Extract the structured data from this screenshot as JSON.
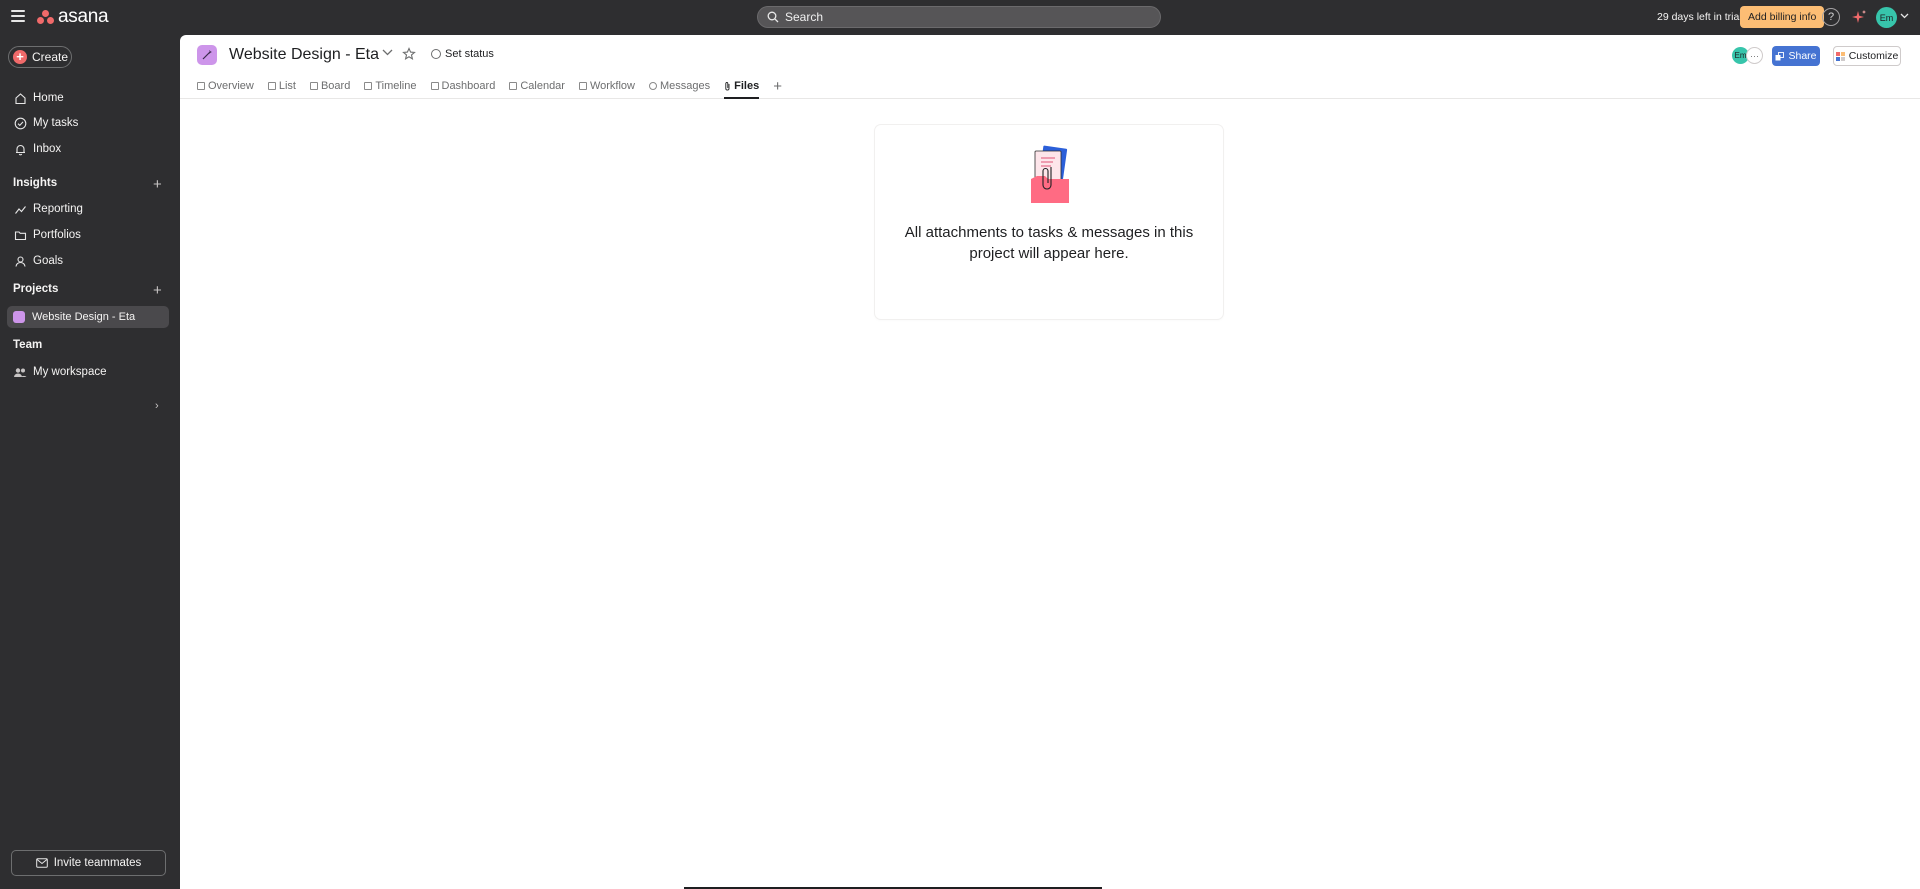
{
  "topbar": {
    "logo_text": "asana",
    "search_placeholder": "Search",
    "trial_text": "29 days left in trial",
    "billing_label": "Add billing info",
    "help_label": "?",
    "avatar_initials": "Em",
    "accent_color": "#f06a6a"
  },
  "sidebar": {
    "create_label": "Create",
    "nav": [
      {
        "label": "Home",
        "icon": "home-icon"
      },
      {
        "label": "My tasks",
        "icon": "check-circle-icon"
      },
      {
        "label": "Inbox",
        "icon": "bell-icon"
      }
    ],
    "insights_header": "Insights",
    "insights": [
      {
        "label": "Reporting",
        "icon": "trend-line-icon"
      },
      {
        "label": "Portfolios",
        "icon": "folder-icon"
      },
      {
        "label": "Goals",
        "icon": "person-icon"
      }
    ],
    "projects_header": "Projects",
    "projects": [
      {
        "label": "Website Design - Eta",
        "color": "#cd95ea"
      }
    ],
    "team_header": "Team",
    "team": [
      {
        "label": "My workspace",
        "icon": "people-icon"
      }
    ],
    "invite_label": "Invite teammates"
  },
  "project": {
    "title": "Website Design - Eta",
    "set_status_label": "Set status",
    "member_initials": "Em",
    "more_members": "···",
    "share_label": "Share",
    "customize_label": "Customize",
    "tabs": [
      {
        "label": "Overview",
        "icon": "overview-icon"
      },
      {
        "label": "List",
        "icon": "list-icon"
      },
      {
        "label": "Board",
        "icon": "board-icon"
      },
      {
        "label": "Timeline",
        "icon": "timeline-icon"
      },
      {
        "label": "Dashboard",
        "icon": "dashboard-icon"
      },
      {
        "label": "Calendar",
        "icon": "calendar-icon"
      },
      {
        "label": "Workflow",
        "icon": "workflow-icon"
      },
      {
        "label": "Messages",
        "icon": "message-icon"
      },
      {
        "label": "Files",
        "icon": "paperclip-icon",
        "active": true
      }
    ],
    "add_tab_label": "+"
  },
  "files": {
    "empty_message": "All attachments to tasks & messages in this project will appear here."
  }
}
